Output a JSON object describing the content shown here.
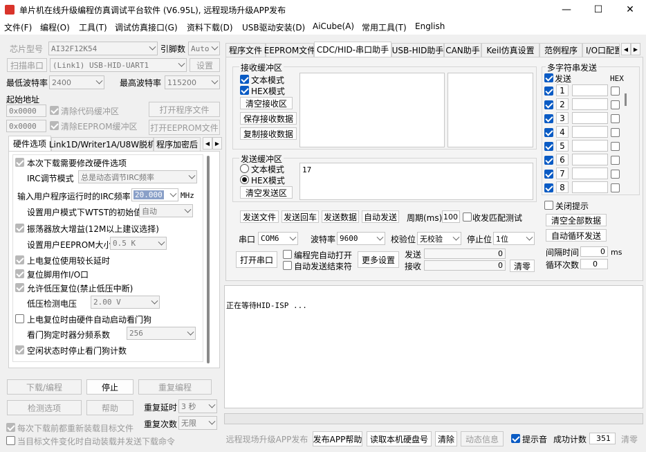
{
  "title": "单片机在线升级编程仿真调试平台软件 (V6.95L), 远程现场升级APP发布",
  "menu": [
    "文件(F)",
    "编程(O)",
    "工具(T)",
    "调试仿真接口(G)",
    "资料下载(D)",
    "USB驱动安装(D)",
    "AiCube(A)",
    "常用工具(T)",
    "English"
  ],
  "left": {
    "chip_label": "芯片型号",
    "chip_value": "AI32F12K54",
    "pin_label": "引脚数",
    "pin_value": "Auto",
    "scan_label": "扫描串口",
    "port_value": "(Link1) USB-HID-UART1",
    "settings": "设置",
    "min_baud_label": "最低波特率",
    "min_baud": "2400",
    "max_baud_label": "最高波特率",
    "max_baud": "115200",
    "start_addr": "起始地址",
    "addr1": "0x0000",
    "clear_code": "清除代码缓冲区",
    "open_prog": "打开程序文件",
    "addr2": "0x0000",
    "clear_eeprom": "清除EEPROM缓冲区",
    "open_eeprom": "打开EEPROM文件",
    "tabs": [
      "硬件选项",
      "Link1D/Writer1A/U8W脱机",
      "程序加密后"
    ],
    "opts": {
      "o1": "本次下载需要修改硬件选项",
      "irc_mode_label": "IRC调节模式",
      "irc_mode": "总是动态调节IRC频率",
      "irc_freq_label": "输入用户程序运行时的IRC频率",
      "irc_freq": "20.000",
      "mhz": "MHz",
      "wtst_label": "设置用户模式下WTST的初始值",
      "wtst": "自动",
      "o2": "振荡器放大增益(12M以上建议选择)",
      "eeprom_size_label": "设置用户EEPROM大小",
      "eeprom_size": "0.5 K",
      "o3": "上电复位使用较长延时",
      "o4": "复位脚用作I/O口",
      "o5": "允许低压复位(禁止低压中断)",
      "lv_label": "低压检测电压",
      "lv": "2.00 V",
      "o6": "上电复位时由硬件自动启动看门狗",
      "wdt_label": "看门狗定时器分频系数",
      "wdt": "256",
      "o7": "空闲状态时停止看门狗计数"
    },
    "download": "下载/编程",
    "stop": "停止",
    "reprogram": "重复编程",
    "detect": "检测选项",
    "help": "帮助",
    "repeat_delay_label": "重复延时",
    "repeat_delay": "3 秒",
    "repeat_count_label": "重复次数",
    "repeat_count": "无限",
    "reload_each": "每次下载前都重新装载目标文件",
    "auto_reload": "当目标文件变化时自动装载并发送下载命令"
  },
  "right": {
    "tabs": [
      "程序文件",
      "EEPROM文件",
      "CDC/HID-串口助手",
      "USB-HID助手",
      "CAN助手",
      "Keil仿真设置",
      "范例程序",
      "I/O口配置"
    ],
    "recv": {
      "title": "接收缓冲区",
      "text_mode": "文本模式",
      "hex_mode": "HEX模式",
      "clear": "清空接收区",
      "save": "保存接收数据",
      "copy": "复制接收数据"
    },
    "send": {
      "title": "发送缓冲区",
      "text_mode": "文本模式",
      "hex_mode": "HEX模式",
      "clear": "清空发送区",
      "content": "17"
    },
    "row1": {
      "send_file": "发送文件",
      "echo": "发送回车",
      "send_data": "发送数据",
      "auto_send": "自动发送",
      "period_label": "周期(ms)",
      "period": "100",
      "match": "收发匹配测试"
    },
    "multi": {
      "title": "多字符串发送",
      "send": "发送",
      "hex": "HEX",
      "rows": [
        "1",
        "2",
        "3",
        "4",
        "5",
        "6",
        "7",
        "8"
      ],
      "close_tip": "关闭提示",
      "clear_all": "清空全部数据",
      "auto_loop": "自动循环发送",
      "interval_label": "间隔时间",
      "interval": "0",
      "ms": "ms",
      "loop_label": "循环次数",
      "loop": "0"
    },
    "serial": {
      "port_label": "串口",
      "port": "COM6",
      "baud_label": "波特率",
      "baud": "9600",
      "parity_label": "校验位",
      "parity": "无校验",
      "stop_label": "停止位",
      "stop": "1位",
      "open": "打开串口",
      "auto_open": "编程完自动打开",
      "auto_end": "自动发送结束符",
      "more": "更多设置",
      "tx_label": "发送",
      "tx": "0",
      "rx_label": "接收",
      "rx": "0",
      "clear": "清零"
    },
    "log": "正在等待HID-ISP ..."
  },
  "bottom": {
    "remote": "远程现场升级APP发布",
    "publish_help": "发布APP帮助",
    "read_disk": "读取本机硬盘号",
    "clear": "清除",
    "anim": "动态信息",
    "beep": "提示音",
    "success_label": "成功计数",
    "success": "351",
    "zero": "清零"
  }
}
